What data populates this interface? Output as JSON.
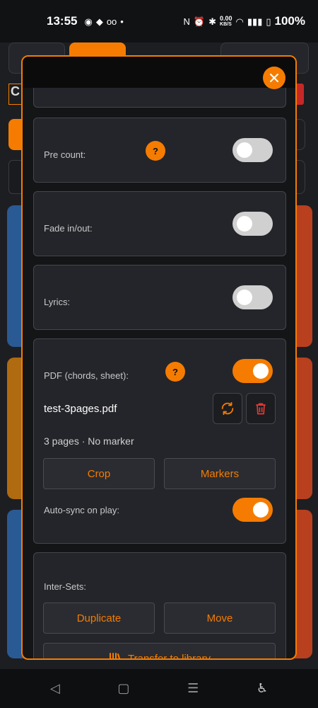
{
  "status": {
    "time": "13:55",
    "net_speed": "0.00",
    "net_unit": "KB/S",
    "battery": "100%"
  },
  "colors": {
    "accent": "#f57c00",
    "modal_bg": "#141517",
    "section_bg": "#24252a"
  },
  "settings": {
    "pre_count": {
      "label": "Pre count:",
      "help": "?",
      "on": false
    },
    "fade": {
      "label": "Fade in/out:",
      "on": false
    },
    "lyrics": {
      "label": "Lyrics:",
      "on": false
    },
    "pdf": {
      "label": "PDF (chords, sheet):",
      "help": "?",
      "on": true,
      "filename": "test-3pages.pdf",
      "info": "3 pages · No marker",
      "crop_label": "Crop",
      "markers_label": "Markers",
      "autosync_label": "Auto-sync on play:",
      "autosync_on": true
    },
    "inter_sets": {
      "label": "Inter-Sets:",
      "duplicate_label": "Duplicate",
      "move_label": "Move",
      "transfer_label": "Transfer to library"
    }
  },
  "icons": {
    "close": "close-icon",
    "sync": "sync-icon",
    "delete": "trash-icon",
    "transfer": "transfer-icon"
  }
}
